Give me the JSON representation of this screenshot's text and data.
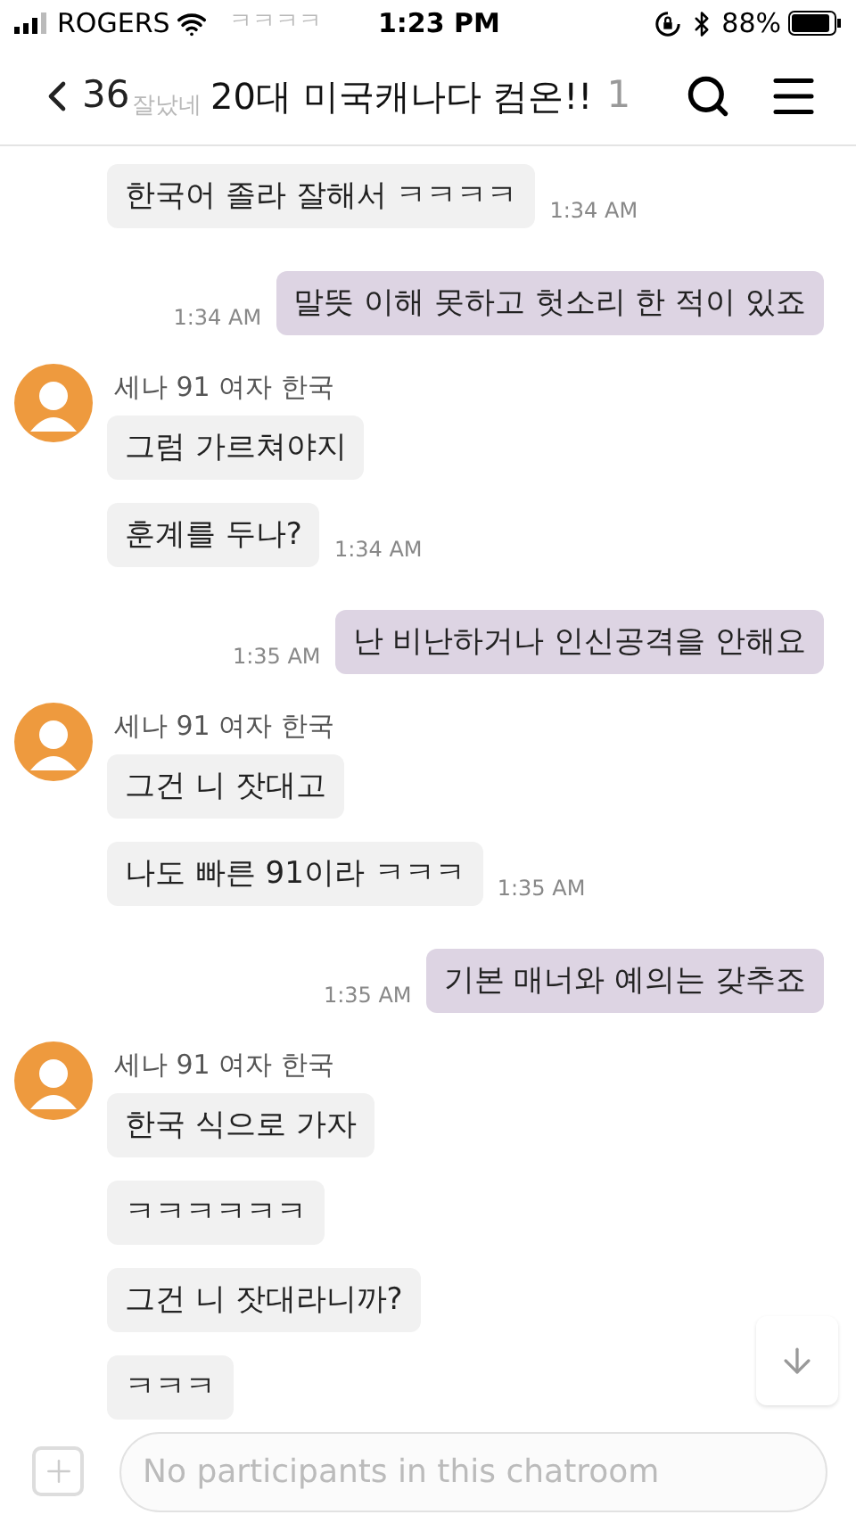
{
  "status_bar": {
    "carrier": "ROGERS",
    "time": "1:23 PM",
    "battery": "88%"
  },
  "behind_header": [
    "ㅋㅋㅋㅋ",
    "잘났네"
  ],
  "header": {
    "back_count": "36",
    "title": "20대 미국캐나다 컴온!!",
    "member_count": "1"
  },
  "messages": [
    {
      "kind": "in",
      "text": "한국어 졸라 잘해서 ㅋㅋㅋㅋ",
      "time": "1:34 AM"
    },
    {
      "kind": "out",
      "text": "말뜻 이해 못하고 헛소리 한 적이 있죠",
      "time": "1:34 AM"
    },
    {
      "kind": "sender",
      "name": "세나 91 여자 한국"
    },
    {
      "kind": "in",
      "text": "그럼 가르쳐야지"
    },
    {
      "kind": "in",
      "text": "훈계를 두나?",
      "time": "1:34 AM"
    },
    {
      "kind": "out",
      "text": "난 비난하거나 인신공격을 안해요",
      "time": "1:35 AM"
    },
    {
      "kind": "sender",
      "name": "세나 91 여자 한국"
    },
    {
      "kind": "in",
      "text": "그건 니 잣대고"
    },
    {
      "kind": "in",
      "text": "나도 빠른 91이라 ㅋㅋㅋ",
      "time": "1:35 AM"
    },
    {
      "kind": "out",
      "text": "기본 매너와 예의는 갖추죠",
      "time": "1:35 AM"
    },
    {
      "kind": "sender",
      "name": "세나 91 여자 한국"
    },
    {
      "kind": "in",
      "text": "한국 식으로 가자"
    },
    {
      "kind": "in",
      "text": "ㅋㅋㅋㅋㅋㅋ"
    },
    {
      "kind": "in",
      "text": "그건 니 잣대라니까?"
    },
    {
      "kind": "in",
      "text": "ㅋㅋㅋ"
    }
  ],
  "composer": {
    "placeholder": "No participants in this chatroom"
  }
}
